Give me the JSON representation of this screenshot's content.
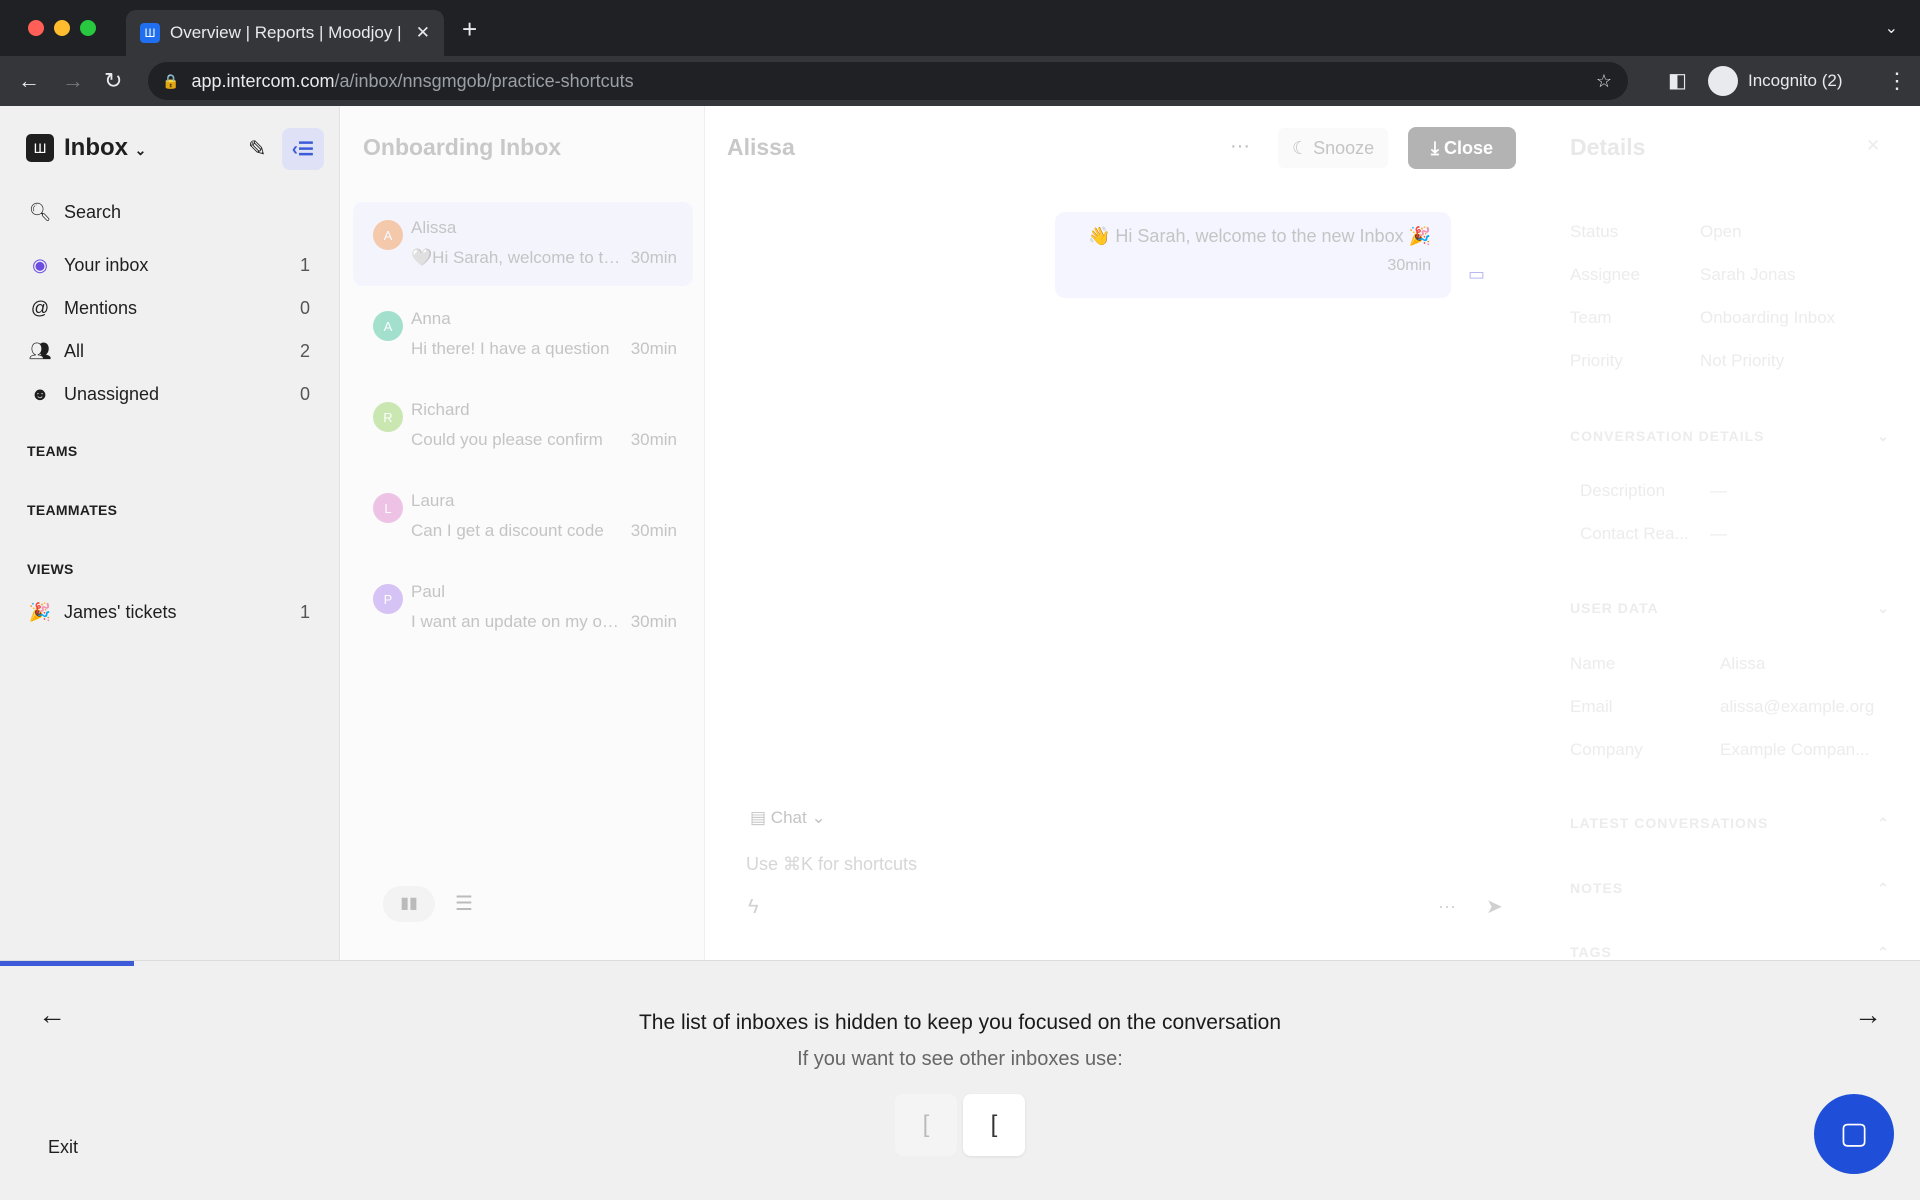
{
  "browser": {
    "tab_title": "Overview | Reports | Moodjoy |",
    "url_host": "app.intercom.com",
    "url_path": "/a/inbox/nnsgmgob/practice-shortcuts",
    "profile": "Incognito (2)"
  },
  "sidebar": {
    "title": "Inbox",
    "search": "Search",
    "items": [
      {
        "label": "Your inbox",
        "count": "1",
        "icon": "bot-face-icon"
      },
      {
        "label": "Mentions",
        "count": "0",
        "icon": "at-icon"
      },
      {
        "label": "All",
        "count": "2",
        "icon": "people-icon"
      },
      {
        "label": "Unassigned",
        "count": "0",
        "icon": "unassigned-icon"
      }
    ],
    "sections": {
      "teams": "TEAMS",
      "teammates": "TEAMMATES",
      "views": "VIEWS"
    },
    "views": [
      {
        "label": "James' tickets",
        "count": "1",
        "icon": "party-popper-icon"
      }
    ]
  },
  "list": {
    "title": "Onboarding Inbox",
    "conversations": [
      {
        "initial": "A",
        "name": "Alissa",
        "preview": "🤍Hi Sarah, welcome to the new Inbox",
        "time": "30min",
        "color": "#f59e5b"
      },
      {
        "initial": "A",
        "name": "Anna",
        "preview": "Hi there! I have a question",
        "time": "30min",
        "color": "#4cc7a0"
      },
      {
        "initial": "R",
        "name": "Richard",
        "preview": "Could you please confirm",
        "time": "30min",
        "color": "#9ad36a"
      },
      {
        "initial": "L",
        "name": "Laura",
        "preview": "Can I get a discount code",
        "time": "30min",
        "color": "#e08bd0"
      },
      {
        "initial": "P",
        "name": "Paul",
        "preview": "I want an update on my order",
        "time": "30min",
        "color": "#b38cf0"
      }
    ]
  },
  "conversation": {
    "title": "Alissa",
    "snooze": "Snooze",
    "close": "Close",
    "message": "👋 Hi Sarah, welcome to the new Inbox 🎉",
    "message_time": "30min",
    "composer_mode": "Chat",
    "composer_placeholder": "Use ⌘K for shortcuts"
  },
  "details": {
    "title": "Details",
    "rows": [
      {
        "k": "Status",
        "v": "Open"
      },
      {
        "k": "Assignee",
        "v": "Sarah Jonas"
      },
      {
        "k": "Team",
        "v": "Onboarding Inbox"
      },
      {
        "k": "Priority",
        "v": "Not Priority"
      }
    ],
    "conv_details": "CONVERSATION DETAILS",
    "conv_rows": [
      {
        "k": "Description",
        "v": "—"
      },
      {
        "k": "Contact Rea...",
        "v": "—"
      }
    ],
    "user_data": "USER DATA",
    "user_rows": [
      {
        "k": "Name",
        "v": "Alissa"
      },
      {
        "k": "Email",
        "v": "alissa@example.org"
      },
      {
        "k": "Company",
        "v": "Example Compan..."
      }
    ],
    "latest": "LATEST CONVERSATIONS",
    "notes": "NOTES",
    "tags": "TAGS"
  },
  "tutorial": {
    "heading": "The list of inboxes is hidden to keep you focused on the conversation",
    "sub": "If you want to see other inboxes use:",
    "keys": [
      "[",
      "["
    ],
    "exit": "Exit",
    "progress_percent": 7,
    "accent": "#3d5bd9"
  }
}
